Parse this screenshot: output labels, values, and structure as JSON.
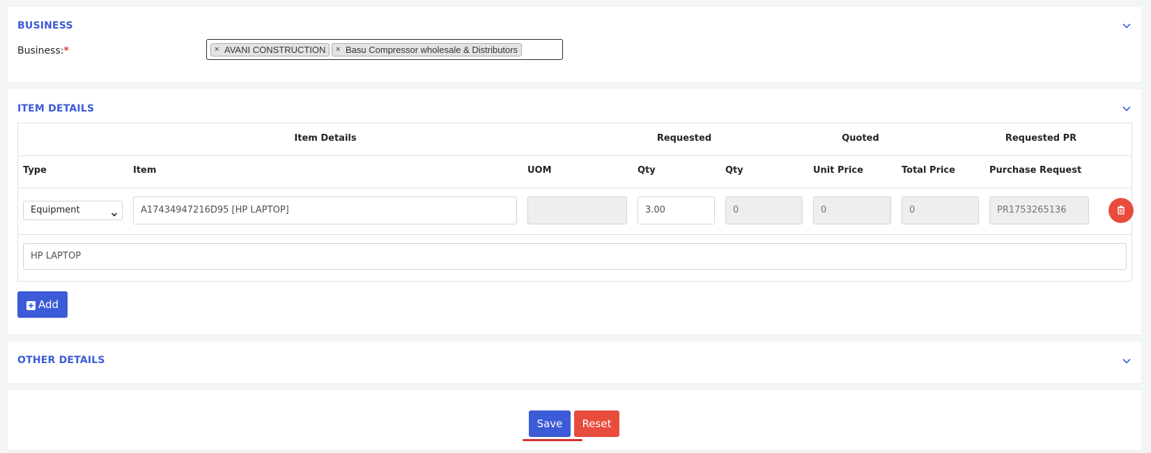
{
  "business_section": {
    "title": "BUSINESS",
    "field_label": "Business:",
    "required_mark": "*",
    "selected": [
      {
        "label": "AVANI CONSTRUCTION",
        "remove": "×"
      },
      {
        "label": "Basu Compressor wholesale & Distributors",
        "remove": "×"
      }
    ]
  },
  "item_section": {
    "title": "ITEM DETAILS",
    "group_headers": {
      "item_details": "Item Details",
      "requested": "Requested",
      "quoted": "Quoted",
      "requested_pr": "Requested PR"
    },
    "columns": {
      "type": "Type",
      "item": "Item",
      "uom": "UOM",
      "req_qty": "Qty",
      "quoted_qty": "Qty",
      "unit_price": "Unit Price",
      "total_price": "Total Price",
      "purchase_request": "Purchase Request"
    },
    "row": {
      "type": "Equipment",
      "item": "A17434947216D95 [HP LAPTOP]",
      "uom": "",
      "req_qty": "3.00",
      "quoted_qty": "0",
      "unit_price": "0",
      "total_price": "0",
      "purchase_request": "PR1753265136",
      "description": "HP LAPTOP"
    },
    "add_label": "Add"
  },
  "other_section": {
    "title": "OTHER DETAILS"
  },
  "actions": {
    "save_label": "Save",
    "reset_label": "Reset"
  },
  "colors": {
    "accent": "#3c5bd6",
    "danger": "#e74c3c"
  },
  "icons": {
    "collapse": "chevron-down-icon",
    "remove_tag": "close-icon",
    "delete_row": "trash-icon",
    "add": "plus-square-icon"
  }
}
